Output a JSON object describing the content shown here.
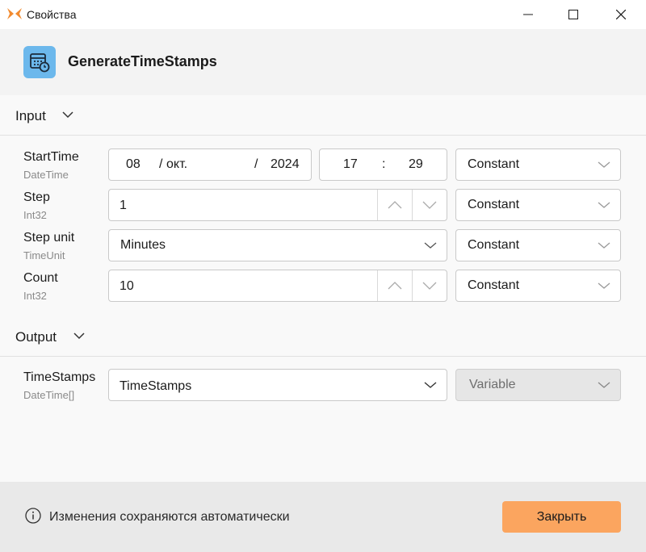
{
  "window": {
    "title": "Свойства",
    "controls": [
      "minimize",
      "maximize",
      "close"
    ]
  },
  "header": {
    "activity_name": "GenerateTimeStamps",
    "icon": "calendar-clock-icon"
  },
  "sections": {
    "input_label": "Input",
    "output_label": "Output"
  },
  "inputs": [
    {
      "name": "StartTime",
      "type": "DateTime",
      "date": {
        "day": "08",
        "sep1": "/",
        "month": "окт.",
        "sep2": "/",
        "year": "2024"
      },
      "time": {
        "hour": "17",
        "sep": ":",
        "minute": "29"
      },
      "mode": "Constant"
    },
    {
      "name": "Step",
      "type": "Int32",
      "value": "1",
      "mode": "Constant"
    },
    {
      "name": "Step unit",
      "type": "TimeUnit",
      "value": "Minutes",
      "mode": "Constant"
    },
    {
      "name": "Count",
      "type": "Int32",
      "value": "10",
      "mode": "Constant"
    }
  ],
  "outputs": [
    {
      "name": "TimeStamps",
      "type": "DateTime[]",
      "value": "TimeStamps",
      "mode": "Variable"
    }
  ],
  "footer": {
    "note": "Изменения сохраняются автоматически",
    "close_label": "Закрыть",
    "accent": "#fba55f"
  }
}
